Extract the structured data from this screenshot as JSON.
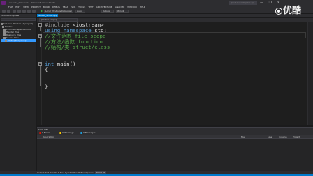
{
  "titlebar": {
    "title": "Lesson01_helloworld - Microsoft Visual Studio",
    "quick_launch_placeholder": "Quick Launch (Ctrl+Q)",
    "controls": "— ❐ ✕"
  },
  "menu": [
    "FILE",
    "EDIT",
    "VIEW",
    "PROJECT",
    "BUILD",
    "DEBUG",
    "TEAM",
    "SQL",
    "TOOLS",
    "TEST",
    "ARCHITECTURE",
    "ANALYZE",
    "WINDOW",
    "HELP"
  ],
  "toolbar": {
    "run_label": "Local Windows Debugger",
    "config": "Debug",
    "platform": "Win32",
    "auto": "Auto"
  },
  "solution_explorer": {
    "title": "Solution Explorer",
    "items": [
      {
        "label": "Solution 'Pointer' (1 project)",
        "selected": false
      },
      {
        "label": "Pointer",
        "selected": false
      },
      {
        "label": "External Dependencies",
        "selected": false
      },
      {
        "label": "Header Files",
        "selected": false
      },
      {
        "label": "Resource Files",
        "selected": false
      },
      {
        "label": "Source Files",
        "selected": false
      },
      {
        "label": "Global_Scope.cpp",
        "selected": true
      }
    ]
  },
  "editor": {
    "active_tab": "Global_Scope.cpp*",
    "scope": "(Global Scope)",
    "lines": [
      {
        "pp": "#include",
        "rest": " <iostream>"
      },
      {
        "kw": "using namespace",
        "rest": " std;"
      },
      {
        "cm": "//文件范围 file scope"
      },
      {
        "cm": "//方法/函数 function"
      },
      {
        "cm": "//结构/类 struct/class"
      },
      {
        "blank": ""
      },
      {
        "blank": ""
      },
      {
        "kw": "int",
        "rest": " main()"
      },
      {
        "rest": "{"
      },
      {
        "rest": ""
      },
      {
        "rest": "}"
      }
    ]
  },
  "error_list": {
    "title": "Error List",
    "filters": {
      "errors": "0 Errors",
      "warnings": "0 Warnings",
      "messages": "0 Messages"
    },
    "columns": {
      "description": "Description",
      "file": "File",
      "line": "Line",
      "column": "Column",
      "project": "Project"
    }
  },
  "bottom_tabs": [
    "Output",
    "Find Results 1",
    "Find Symbol Results",
    "Breakpoints",
    "Error List"
  ],
  "watermark": {
    "text": "优酷"
  },
  "colors": {
    "accent": "#007acc",
    "background": "#1e1e1e",
    "comment": "#57a64a",
    "keyword": "#569cd6"
  }
}
